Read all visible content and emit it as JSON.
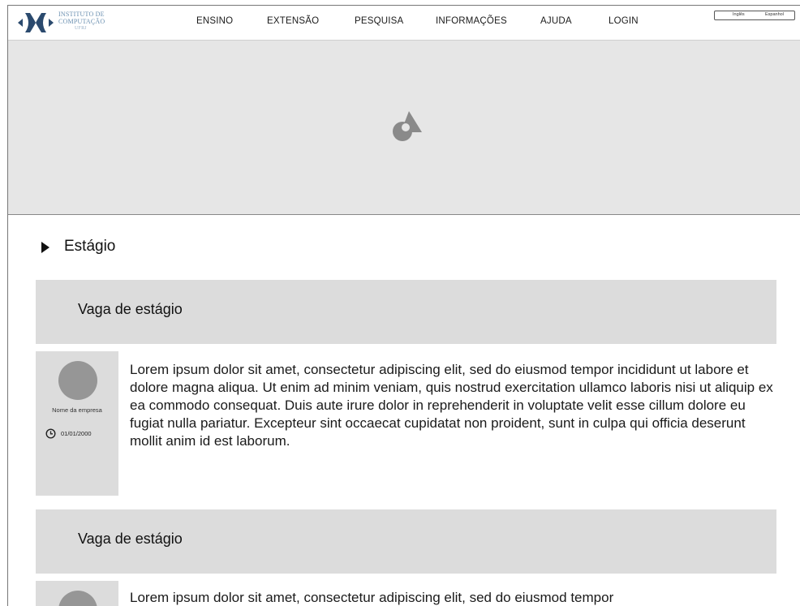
{
  "brand": {
    "name_line1": "INSTITUTO DE",
    "name_line2": "COMPUTAÇÃO",
    "name_sub": "UFRJ",
    "accent_color": "#2b4a6e"
  },
  "nav": {
    "items": [
      "ENSINO",
      "EXTENSÃO",
      "PESQUISA",
      "INFORMAÇÕES",
      "AJUDA",
      "LOGIN"
    ]
  },
  "languages": [
    "Inglês",
    "Espanhol"
  ],
  "hero": {
    "icon": "image-placeholder-icon"
  },
  "section": {
    "title": "Estágio",
    "icon": "caret-right-icon"
  },
  "jobs": [
    {
      "title": "Vaga de estágio",
      "company": "Nome da empresa",
      "date": "01/01/2000",
      "description": "Lorem ipsum dolor sit amet, consectetur adipiscing elit, sed do eiusmod tempor incididunt ut labore et dolore magna aliqua. Ut enim ad minim veniam, quis nostrud exercitation ullamco laboris nisi ut aliquip ex ea commodo consequat. Duis aute irure dolor in reprehenderit in voluptate velit esse cillum dolore eu fugiat nulla pariatur. Excepteur sint occaecat cupidatat non proident, sunt in culpa qui officia deserunt mollit anim id est laborum."
    },
    {
      "title": "Vaga de estágio",
      "company": "",
      "date": "",
      "description": "Lorem ipsum dolor sit amet, consectetur adipiscing elit, sed do eiusmod tempor"
    }
  ]
}
